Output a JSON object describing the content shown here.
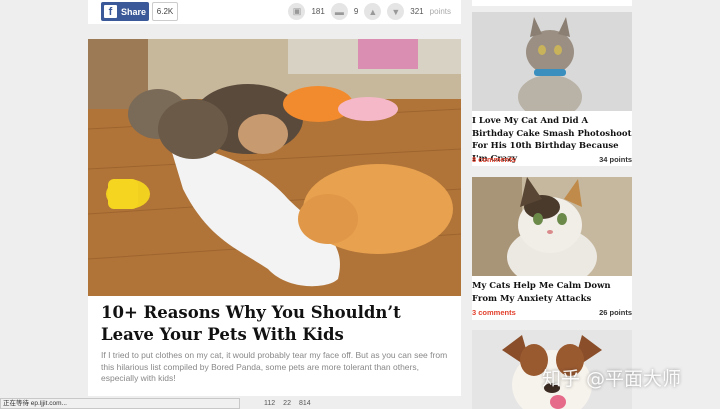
{
  "post": {
    "share_label": "Share",
    "share_count": "6.2K",
    "top_views": "181",
    "top_comments": "9",
    "top_points": "321",
    "points_word": "points",
    "title": "10+ Reasons Why You Shouldn’t Leave Your Pets With Kids",
    "description": "If I tried to put clothes on my cat, it would probably tear my face off. But as you can see from this hilarious list compiled by Bored Panda, some pets are more tolerant than others, especially with kids!",
    "bottom_views": "112",
    "bottom_comments": "22",
    "bottom_points": "814"
  },
  "sidebar": {
    "items": [
      {
        "title": "I Love My Cat And Did A Birthday Cake Smash Photoshoot For His 10th Birthday Because I'm Crazy",
        "comments": "8 comments",
        "points": "34 points"
      },
      {
        "title": "My Cats Help Me Calm Down From My Anxiety Attacks",
        "comments": "3 comments",
        "points": "26 points"
      },
      {
        "title": "",
        "comments": "",
        "points": ""
      }
    ]
  },
  "watermark": "知乎 @平面大师",
  "status_bar": "正在等待 ep.ljjit.com..."
}
